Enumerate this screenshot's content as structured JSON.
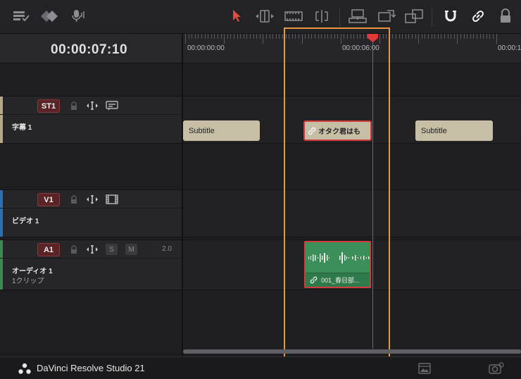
{
  "app": {
    "name": "DaVinci Resolve Studio 21"
  },
  "toolbar": {
    "tools": [
      "timeline-view-options-icon",
      "marker-icon",
      "voiceover-mic-icon",
      "selection-pointer-icon",
      "trim-edit-icon",
      "dynamic-trim-icon",
      "blade-icon",
      "insert-clip-icon",
      "overwrite-clip-icon",
      "replace-clip-icon",
      "snapping-icon",
      "linked-selection-icon",
      "position-lock-icon"
    ]
  },
  "timecode": "00:00:07:10",
  "ruler": {
    "labels": [
      "00:00:00:00",
      "00:00:06:00",
      "00:00:1"
    ]
  },
  "tracks": [
    {
      "id": "ST1",
      "name": "字幕 1",
      "sub": "",
      "color": "#b5a98a"
    },
    {
      "id": "V1",
      "name": "ビデオ 1",
      "sub": "",
      "color": "#2d6fb3"
    },
    {
      "id": "A1",
      "name": "オーディオ 1",
      "sub": "1クリップ",
      "color": "#3c8a52",
      "volume": "2.0",
      "solo": "S",
      "mute": "M"
    }
  ],
  "clips": {
    "subtitle_1": "Subtitle",
    "subtitle_2": "オタク君はも",
    "subtitle_3": "Subtitle",
    "audio": "001_春日部..."
  },
  "colors": {
    "playhead": "#e03a3a",
    "highlight": "#e8953c",
    "audio_clip": "#3d8f5a",
    "subtitle_clip": "#c6bfa6"
  }
}
